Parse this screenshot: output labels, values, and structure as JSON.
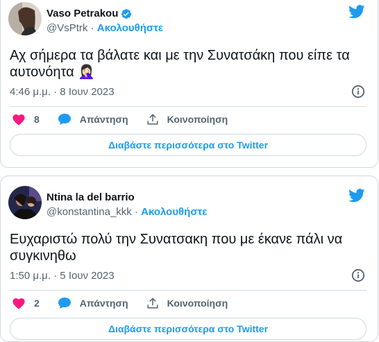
{
  "tweets": [
    {
      "author": "Vaso Petrakou",
      "verified": true,
      "handle": "@VsPtrk",
      "separator": "·",
      "follow_label": "Ακολουθήστε",
      "text": "Αχ σήμερα τα βάλατε και με την Συνατσάκη που είπε τα αυτονόητα",
      "emoji": "🤦🏻‍♀️",
      "timestamp": "4:46 μ.μ. · 8 Ιουν 2023",
      "likes": "8",
      "reply_label": "Απάντηση",
      "share_label": "Κοινοποίηση",
      "read_more_label": "Διαβάστε περισσότερα στο Twitter"
    },
    {
      "author": "Ntina la del barrio",
      "verified": false,
      "handle": "@konstantina_kkk",
      "separator": "·",
      "follow_label": "Ακολουθήστε",
      "text": "Ευχαριστώ πολύ την Συνατσακη που με έκανε πάλι να συγκινηθω",
      "timestamp": "1:50 μ.μ. · 5 Ιουν 2023",
      "likes": "2",
      "reply_label": "Απάντηση",
      "share_label": "Κοινοποίηση",
      "read_more_label": "Διαβάστε περισσότερα στο Twitter"
    }
  ],
  "colors": {
    "accent": "#1d9bf0",
    "like": "#f91880",
    "muted": "#536471",
    "border": "#cfd9de",
    "text": "#0f1419"
  },
  "icons": {
    "bird": "twitter-bird-icon",
    "verified": "verified-badge-icon",
    "like": "heart-icon",
    "reply": "speech-bubble-icon",
    "share": "share-upload-icon",
    "info": "info-icon"
  }
}
